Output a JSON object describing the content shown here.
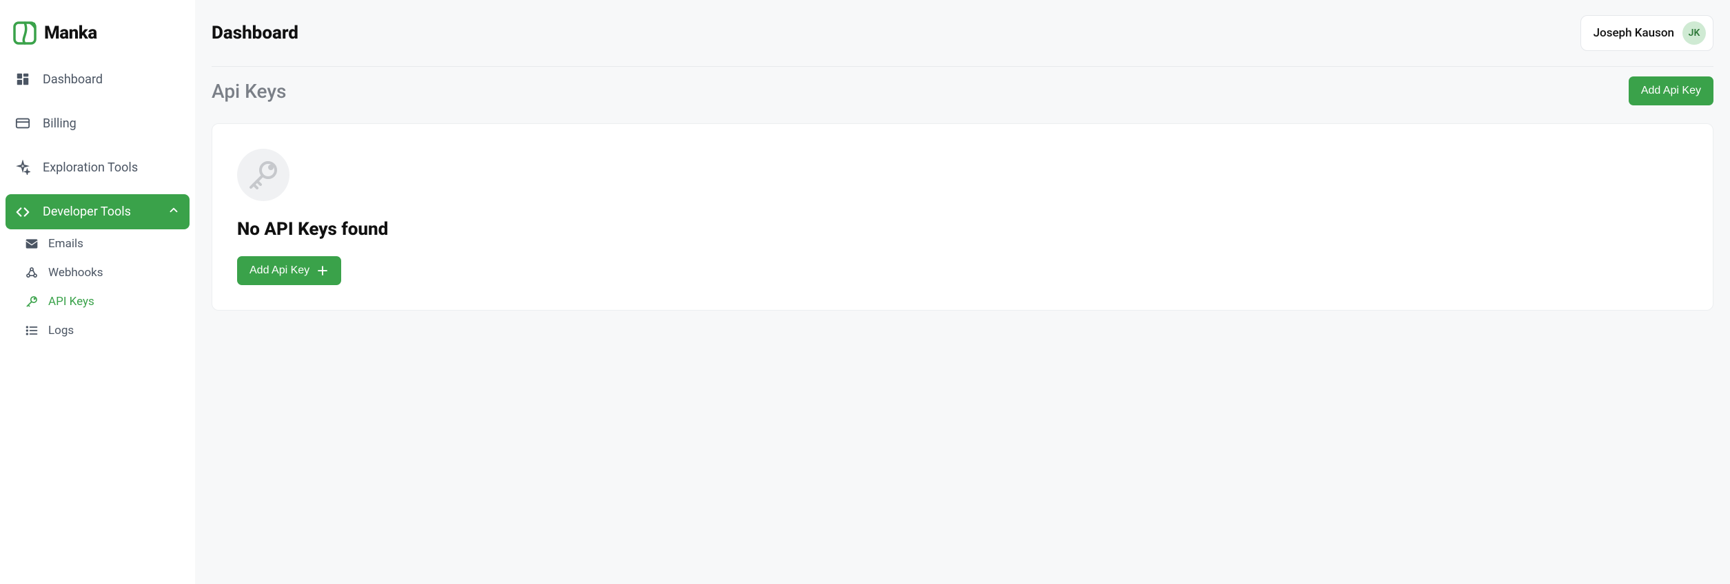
{
  "brand": {
    "name": "Manka"
  },
  "user": {
    "name": "Joseph Kauson",
    "initials": "JK"
  },
  "header": {
    "title": "Dashboard"
  },
  "sidebar": {
    "items": [
      {
        "label": "Dashboard"
      },
      {
        "label": "Billing"
      },
      {
        "label": "Exploration Tools"
      },
      {
        "label": "Developer Tools"
      }
    ],
    "developer_sub": [
      {
        "label": "Emails"
      },
      {
        "label": "Webhooks"
      },
      {
        "label": "API Keys"
      },
      {
        "label": "Logs"
      }
    ]
  },
  "section": {
    "title": "Api Keys",
    "add_button": "Add Api Key"
  },
  "empty_state": {
    "title": "No API Keys found",
    "button": "Add Api Key"
  }
}
